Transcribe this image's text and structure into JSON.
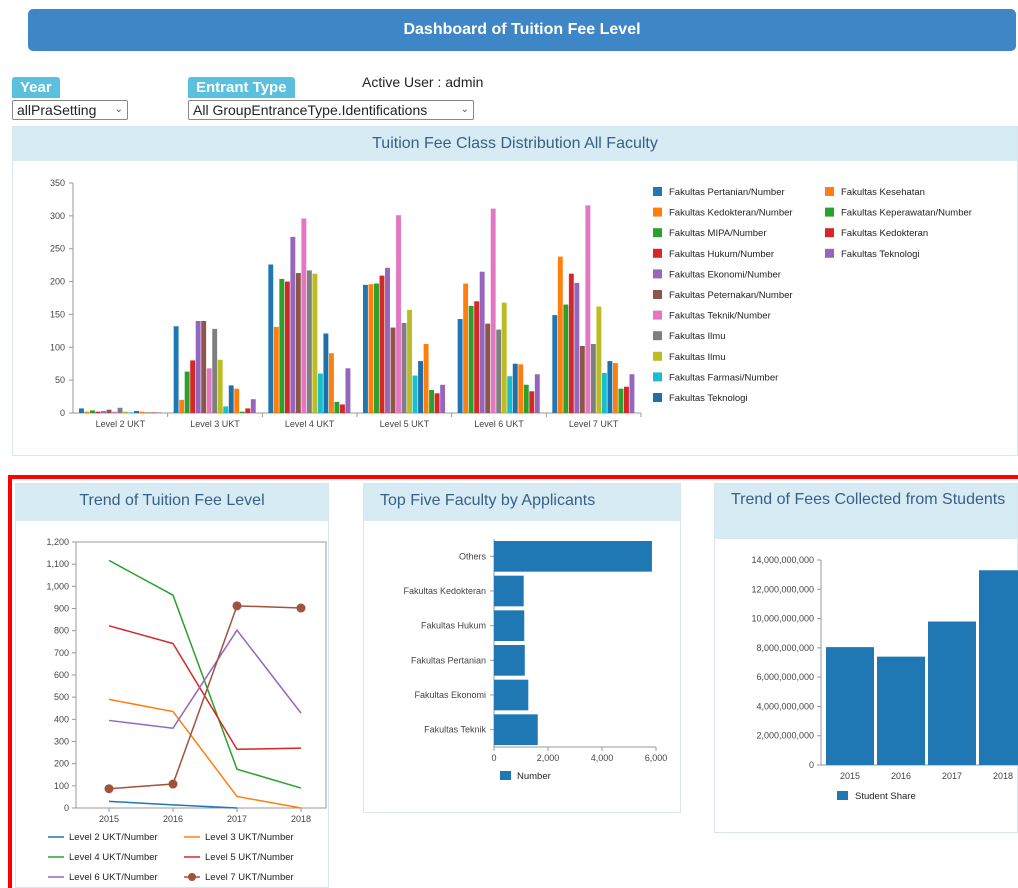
{
  "header": {
    "title": "Dashboard of Tuition Fee Level"
  },
  "filters": {
    "year": {
      "label": "Year",
      "value": "allPraSetting"
    },
    "entrant_type": {
      "label": "Entrant Type",
      "value": "All GroupEntranceType.Identifications"
    }
  },
  "active_user": "Active User : admin",
  "panels": {
    "distribution": "Tuition Fee Class Distribution All Faculty",
    "trend": "Trend of Tuition Fee Level",
    "top_five": "Top Five Faculty by Applicants",
    "fees": "Trend of Fees Collected from Students"
  },
  "icons": {
    "select_chevron": "chevron-down-icon"
  },
  "chart_data": [
    {
      "type": "bar",
      "title": "Tuition Fee Class Distribution All Faculty",
      "categories": [
        "Level 2 UKT",
        "Level 3 UKT",
        "Level 4 UKT",
        "Level 5 UKT",
        "Level 6 UKT",
        "Level 7 UKT"
      ],
      "ylim": [
        0,
        350
      ],
      "yticks": [
        0,
        50,
        100,
        150,
        200,
        250,
        300,
        350
      ],
      "legend_position": "right",
      "series": [
        {
          "name": "Fakultas Pertanian/Number",
          "color": "#1f77b4",
          "values": [
            7,
            132,
            226,
            195,
            143,
            149
          ]
        },
        {
          "name": "Fakultas Kedokteran/Number",
          "color": "#ff7f0e",
          "values": [
            2,
            20,
            131,
            196,
            197,
            238
          ]
        },
        {
          "name": "Fakultas MIPA/Number",
          "color": "#2ca02c",
          "values": [
            4,
            63,
            204,
            197,
            163,
            165
          ]
        },
        {
          "name": "Fakultas Hukum/Number",
          "color": "#d62728",
          "values": [
            2,
            80,
            200,
            209,
            170,
            212
          ]
        },
        {
          "name": "Fakultas Ekonomi/Number",
          "color": "#9467bd",
          "values": [
            3,
            140,
            268,
            221,
            215,
            198
          ]
        },
        {
          "name": "Fakultas Peternakan/Number",
          "color": "#8c564b",
          "values": [
            5,
            140,
            213,
            130,
            136,
            102
          ]
        },
        {
          "name": "Fakultas Teknik/Number",
          "color": "#e377c2",
          "values": [
            2,
            68,
            296,
            301,
            311,
            316
          ]
        },
        {
          "name": "Fakultas Ilmu",
          "color": "#7f7f7f",
          "values": [
            8,
            128,
            217,
            137,
            127,
            105
          ]
        },
        {
          "name": "Fakultas Ilmu",
          "color": "#bcbd22",
          "values": [
            2,
            81,
            212,
            157,
            168,
            162
          ]
        },
        {
          "name": "Fakultas Farmasi/Number",
          "color": "#17becf",
          "values": [
            1,
            10,
            60,
            57,
            56,
            61
          ]
        },
        {
          "name": "Fakultas Teknologi",
          "color": "#1f6fa8",
          "values": [
            3,
            42,
            121,
            79,
            75,
            79
          ]
        },
        {
          "name": "Fakultas Kesehatan",
          "color": "#ff7f0e",
          "values": [
            2,
            37,
            91,
            105,
            74,
            76
          ]
        },
        {
          "name": "Fakultas Keperawatan/Number",
          "color": "#2ca02c",
          "values": [
            1,
            2,
            17,
            35,
            43,
            37
          ]
        },
        {
          "name": "Fakultas Kedokteran",
          "color": "#d62728",
          "values": [
            1,
            7,
            13,
            30,
            33,
            40
          ]
        },
        {
          "name": "Fakultas Teknologi",
          "color": "#9467bd",
          "values": [
            1,
            21,
            68,
            43,
            59,
            59
          ]
        }
      ]
    },
    {
      "type": "line",
      "title": "Trend of Tuition Fee Level",
      "x": [
        "2015",
        "2016",
        "2017",
        "2018"
      ],
      "ylim": [
        0,
        1200
      ],
      "yticks": [
        0,
        100,
        200,
        300,
        400,
        500,
        600,
        700,
        800,
        900,
        "1,000",
        "1,100",
        "1,200"
      ],
      "legend_position": "bottom",
      "series": [
        {
          "name": "Level 2 UKT/Number",
          "color": "#1f77b4",
          "values": [
            30,
            14,
            0,
            null
          ],
          "markers": false
        },
        {
          "name": "Level 3 UKT/Number",
          "color": "#ff7f0e",
          "values": [
            490,
            435,
            52,
            0
          ],
          "markers": false
        },
        {
          "name": "Level 4 UKT/Number",
          "color": "#2ca02c",
          "values": [
            1117,
            960,
            175,
            90
          ],
          "markers": false
        },
        {
          "name": "Level 5 UKT/Number",
          "color": "#d62728",
          "values": [
            822,
            742,
            265,
            270
          ],
          "markers": false
        },
        {
          "name": "Level 6 UKT/Number",
          "color": "#9467bd",
          "values": [
            395,
            360,
            802,
            428
          ],
          "markers": false
        },
        {
          "name": "Level 7 UKT/Number",
          "color": "#a0523d",
          "values": [
            87,
            108,
            912,
            902
          ],
          "markers": true
        }
      ]
    },
    {
      "type": "bar",
      "orientation": "horizontal",
      "title": "Top Five Faculty by Applicants",
      "categories": [
        "Others",
        "Fakultas Kedokteran",
        "Fakultas Hukum",
        "Fakultas Pertanian",
        "Fakultas Ekonomi",
        "Fakultas Teknik"
      ],
      "values": [
        5850,
        1100,
        1120,
        1140,
        1270,
        1620
      ],
      "xlim": [
        0,
        6000
      ],
      "xticks": [
        "0",
        "2,000",
        "4,000",
        "6,000"
      ],
      "series_name": "Number",
      "color": "#1f77b4"
    },
    {
      "type": "bar",
      "title": "Trend of Fees Collected from Students",
      "categories": [
        "2015",
        "2016",
        "2017",
        "2018"
      ],
      "values": [
        8050000000,
        7400000000,
        9800000000,
        13300000000
      ],
      "ylim": [
        0,
        14000000000
      ],
      "yticks": [
        "0",
        "2,000,000,000",
        "4,000,000,000",
        "6,000,000,000",
        "8,000,000,000",
        "10,000,000,000",
        "12,000,000,000",
        "14,000,000,000"
      ],
      "series_name": "Student Share",
      "color": "#1f77b4"
    }
  ]
}
